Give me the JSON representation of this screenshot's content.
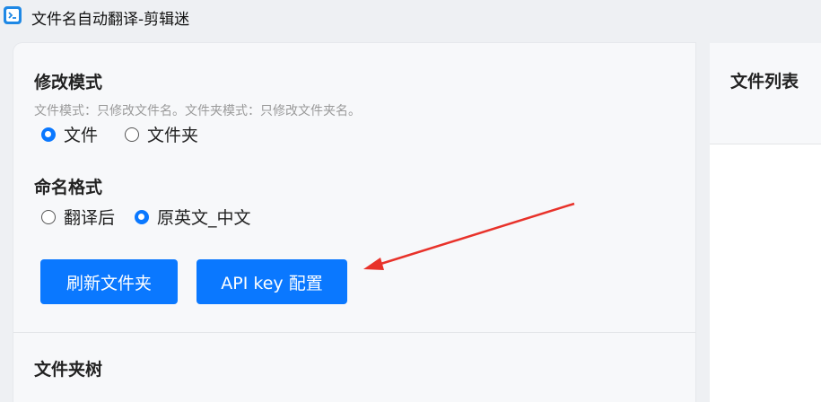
{
  "window": {
    "title": "文件名自动翻译-剪辑迷",
    "app_icon": "terminal-app-icon"
  },
  "modify_mode": {
    "title": "修改模式",
    "hint": "文件模式：只修改文件名。文件夹模式：只修改文件夹名。",
    "options": [
      {
        "label": "文件",
        "checked": true
      },
      {
        "label": "文件夹",
        "checked": false
      }
    ]
  },
  "naming_format": {
    "title": "命名格式",
    "options": [
      {
        "label": "翻译后",
        "checked": false
      },
      {
        "label": "原英文_中文",
        "checked": true
      }
    ]
  },
  "buttons": {
    "refresh_label": "刷新文件夹",
    "api_key_label": "API key 配置"
  },
  "folder_tree": {
    "title": "文件夹树"
  },
  "file_list": {
    "title": "文件列表"
  },
  "colors": {
    "accent": "#0a78ff",
    "annotation_arrow": "#e8322a"
  }
}
